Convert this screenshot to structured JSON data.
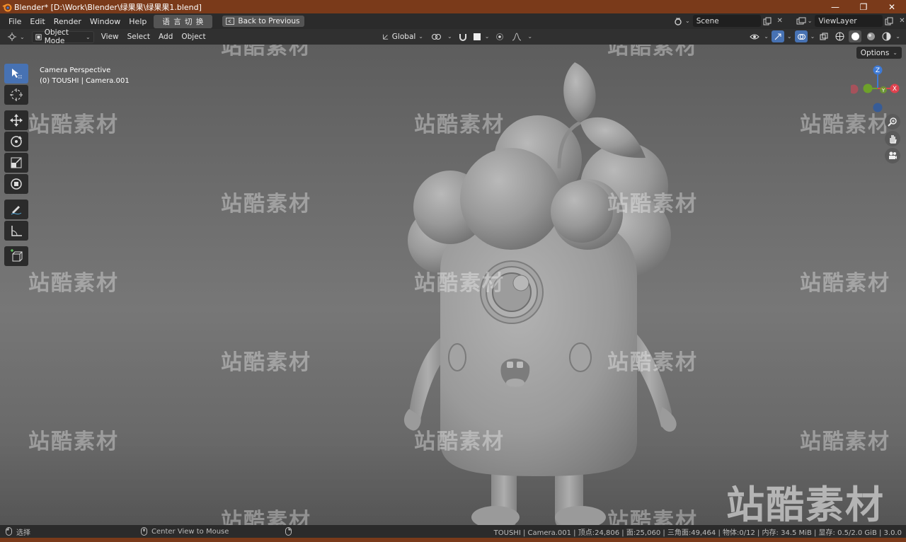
{
  "window": {
    "title": "Blender* [D:\\Work\\Blender\\绿果果\\绿果果1.blend]",
    "controls": [
      "—",
      "❐",
      "✕"
    ]
  },
  "menubar": {
    "items": [
      "File",
      "Edit",
      "Render",
      "Window",
      "Help"
    ],
    "lang_button": "语 言 切 换",
    "back_button": "Back to Previous",
    "scene": "Scene",
    "view_layer": "ViewLayer"
  },
  "header": {
    "mode": "Object Mode",
    "menus": [
      "View",
      "Select",
      "Add",
      "Object"
    ],
    "transform_orientation": "Global",
    "options": "Options"
  },
  "viewport": {
    "camera_label": "Camera Perspective",
    "object_label": "(0) TOUSHI | Camera.001",
    "gizmo_axes": [
      "Z",
      "Y",
      "X"
    ],
    "watermark": "站酷素材"
  },
  "tools": [
    "select-box",
    "cursor",
    "move",
    "rotate",
    "scale",
    "transform",
    "annotate",
    "measure",
    "add-cube"
  ],
  "statusbar": {
    "select_label": "选择",
    "center_view": "Center View to Mouse",
    "stats": "TOUSHI | Camera.001 | 顶点:24,806 | 面:25,060 | 三角面:49,464 | 物体:0/12 | 内存: 34.5 MiB | 显存: 0.5/2.0 GiB | 3.0.0"
  },
  "colors": {
    "title_bar": "#7a3a1a",
    "active_tool": "#4772b3",
    "axis_x": "#e0414e",
    "axis_y": "#6ea12a",
    "axis_z": "#3e7ad6"
  }
}
